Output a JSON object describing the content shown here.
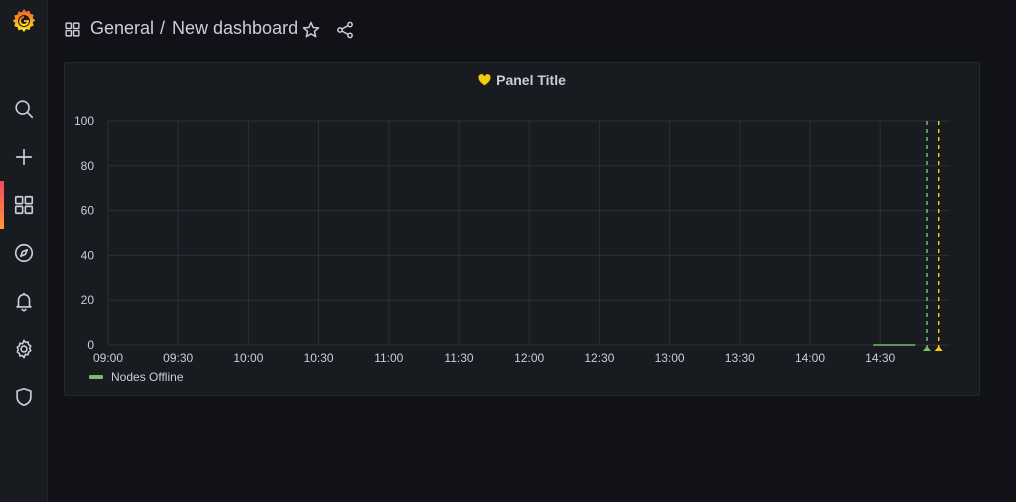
{
  "breadcrumb": {
    "folder": "General",
    "separator": "/",
    "title": "New dashboard"
  },
  "panel": {
    "title": "Panel Title",
    "heart_color": "#f2cc0c"
  },
  "chart_data": {
    "type": "line",
    "title": "Panel Title",
    "x": [
      "09:00",
      "09:30",
      "10:00",
      "10:30",
      "11:00",
      "11:30",
      "12:00",
      "12:30",
      "13:00",
      "13:30",
      "14:00",
      "14:30"
    ],
    "ylim": [
      0,
      100
    ],
    "yticks": [
      0,
      20,
      40,
      60,
      80,
      100
    ],
    "grid": true,
    "legend": "bottom-left",
    "series": [
      {
        "name": "Nodes Offline",
        "color": "#73bf69",
        "points": [
          [
            "14:27",
            0
          ],
          [
            "14:45",
            0
          ]
        ]
      }
    ],
    "annotations": [
      {
        "time": "14:50",
        "color": "#73bf69",
        "style": "dashed"
      },
      {
        "time": "14:55",
        "color": "#f2cc0c",
        "style": "dashed"
      }
    ]
  },
  "colors": {
    "background": "#111217",
    "panel": "#181b1f",
    "text": "#ccccdc",
    "accent_gradient": [
      "#f2495c",
      "#ff9830"
    ]
  },
  "sidebar": {
    "items": [
      {
        "icon": "search-icon"
      },
      {
        "icon": "plus-icon"
      },
      {
        "icon": "dashboards-icon",
        "active": true
      },
      {
        "icon": "compass-icon"
      },
      {
        "icon": "bell-icon"
      },
      {
        "icon": "gear-icon"
      },
      {
        "icon": "shield-icon"
      }
    ]
  }
}
